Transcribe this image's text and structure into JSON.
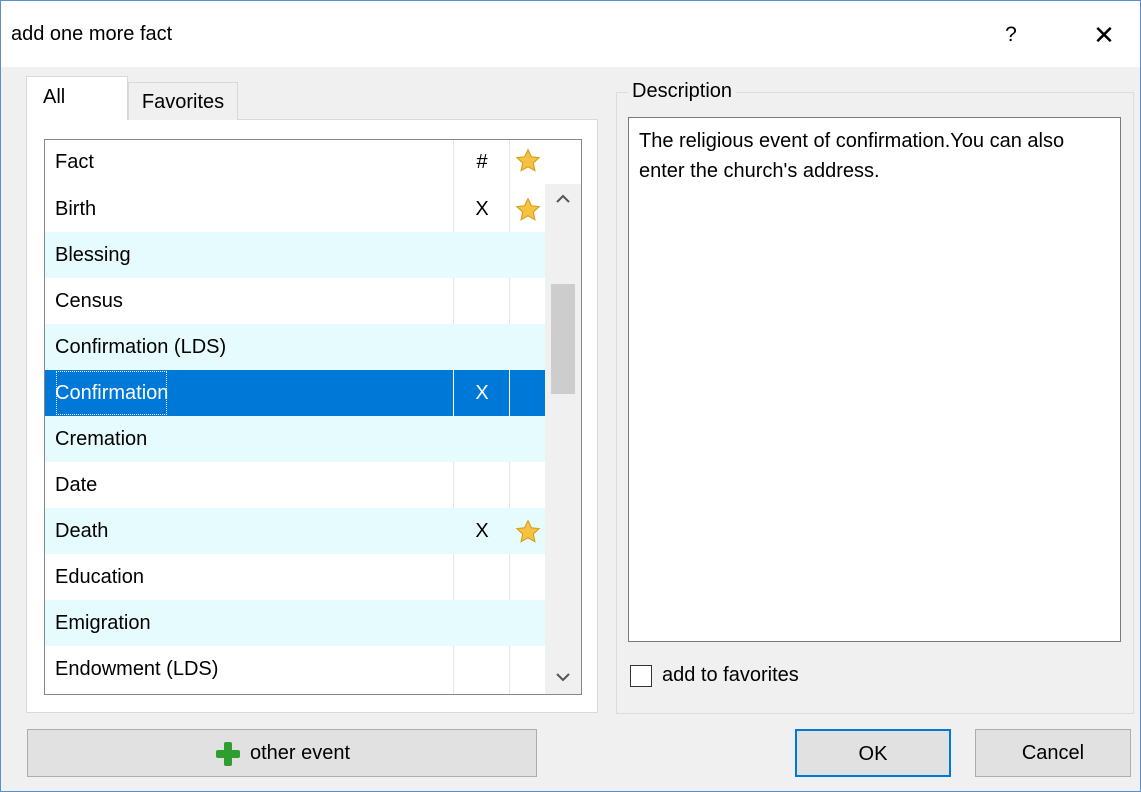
{
  "window": {
    "title": "add one more fact",
    "help_label": "?",
    "close_label": "✕"
  },
  "tabs": [
    {
      "label": "All",
      "active": true
    },
    {
      "label": "Favorites",
      "active": false
    }
  ],
  "list": {
    "headers": {
      "fact": "Fact",
      "number": "#",
      "favorite_icon": "star-icon"
    },
    "rows": [
      {
        "fact": "Birth",
        "number": "X",
        "favorite": true
      },
      {
        "fact": "Blessing",
        "number": "",
        "favorite": false
      },
      {
        "fact": "Census",
        "number": "",
        "favorite": false
      },
      {
        "fact": "Confirmation (LDS)",
        "number": "",
        "favorite": false
      },
      {
        "fact": "Confirmation",
        "number": "X",
        "favorite": false,
        "selected": true
      },
      {
        "fact": "Cremation",
        "number": "",
        "favorite": false
      },
      {
        "fact": "Date",
        "number": "",
        "favorite": false
      },
      {
        "fact": "Death",
        "number": "X",
        "favorite": true
      },
      {
        "fact": "Education",
        "number": "",
        "favorite": false
      },
      {
        "fact": "Emigration",
        "number": "",
        "favorite": false
      },
      {
        "fact": "Endowment (LDS)",
        "number": "",
        "favorite": false
      }
    ],
    "scroll_up": "^",
    "scroll_down": "v"
  },
  "description": {
    "legend": "Description",
    "text": "The religious event of confirmation.You can also enter the church's address.",
    "favorites_checkbox_label": "add to favorites",
    "favorites_checked": false
  },
  "buttons": {
    "other_event": "other event",
    "ok": "OK",
    "cancel": "Cancel"
  },
  "colors": {
    "selection": "#0078d7",
    "alt_row": "#e6fbfd",
    "star": "#f5c242",
    "plus": "#2e9e2e"
  }
}
